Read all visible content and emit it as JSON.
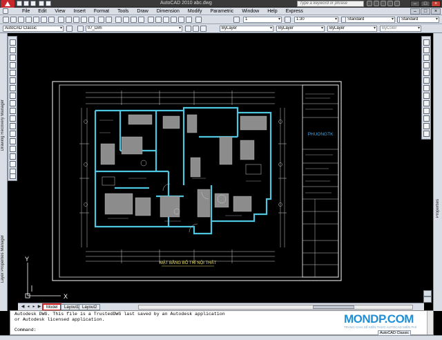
{
  "window": {
    "title": "AutoCAD 2010     abc.dwg",
    "search_placeholder": "Type a keyword or phrase"
  },
  "menu": [
    "File",
    "Edit",
    "View",
    "Insert",
    "Format",
    "Tools",
    "Draw",
    "Dimension",
    "Modify",
    "Parametric",
    "Window",
    "Help",
    "Express"
  ],
  "toolbar1": {
    "scale": "1",
    "ratio": "1:30",
    "text_style": "Standard",
    "dim_style": "Standard"
  },
  "toolbar2": {
    "workspace": "AutoCAD Classic",
    "layer": "07_Dim",
    "color": "ByLayer",
    "linetype": "ByLayer",
    "lineweight": "ByLayer",
    "plotstyle": "ByColor"
  },
  "side_panels": {
    "left_top": "Drawing Recovery Manager",
    "left_bottom": "Layer Properties Manager",
    "right": "Properties"
  },
  "drawing": {
    "title": "MẶT BẰNG BỐ TRÍ NỘI THẤT",
    "logo": "PHUONGTK"
  },
  "ucs": {
    "x": "X",
    "y": "Y"
  },
  "tabs": [
    {
      "label": "Model",
      "active": true
    },
    {
      "label": "Layout1",
      "active": false
    },
    {
      "label": "Layout2",
      "active": false
    }
  ],
  "command": {
    "line1": "Autodesk DWG.  This file is a TrustedDWG last saved by an Autodesk application",
    "line2": "or Autodesk licensed application.",
    "prompt": "Command:"
  },
  "watermark": {
    "title": "MONDP.COM",
    "subtitle": "TRANG CHIA SẺ KIẾN THỨC AUTOCAD MIỄN PHÍ"
  },
  "status": {
    "workspace": "AutoCAD Classic"
  },
  "colors": {
    "paper_border": "#ffffff",
    "walls": "#4fc6e0",
    "dims": "#d0d0d0",
    "title_text": "#e8e070",
    "furniture": "#9a9a9a"
  }
}
